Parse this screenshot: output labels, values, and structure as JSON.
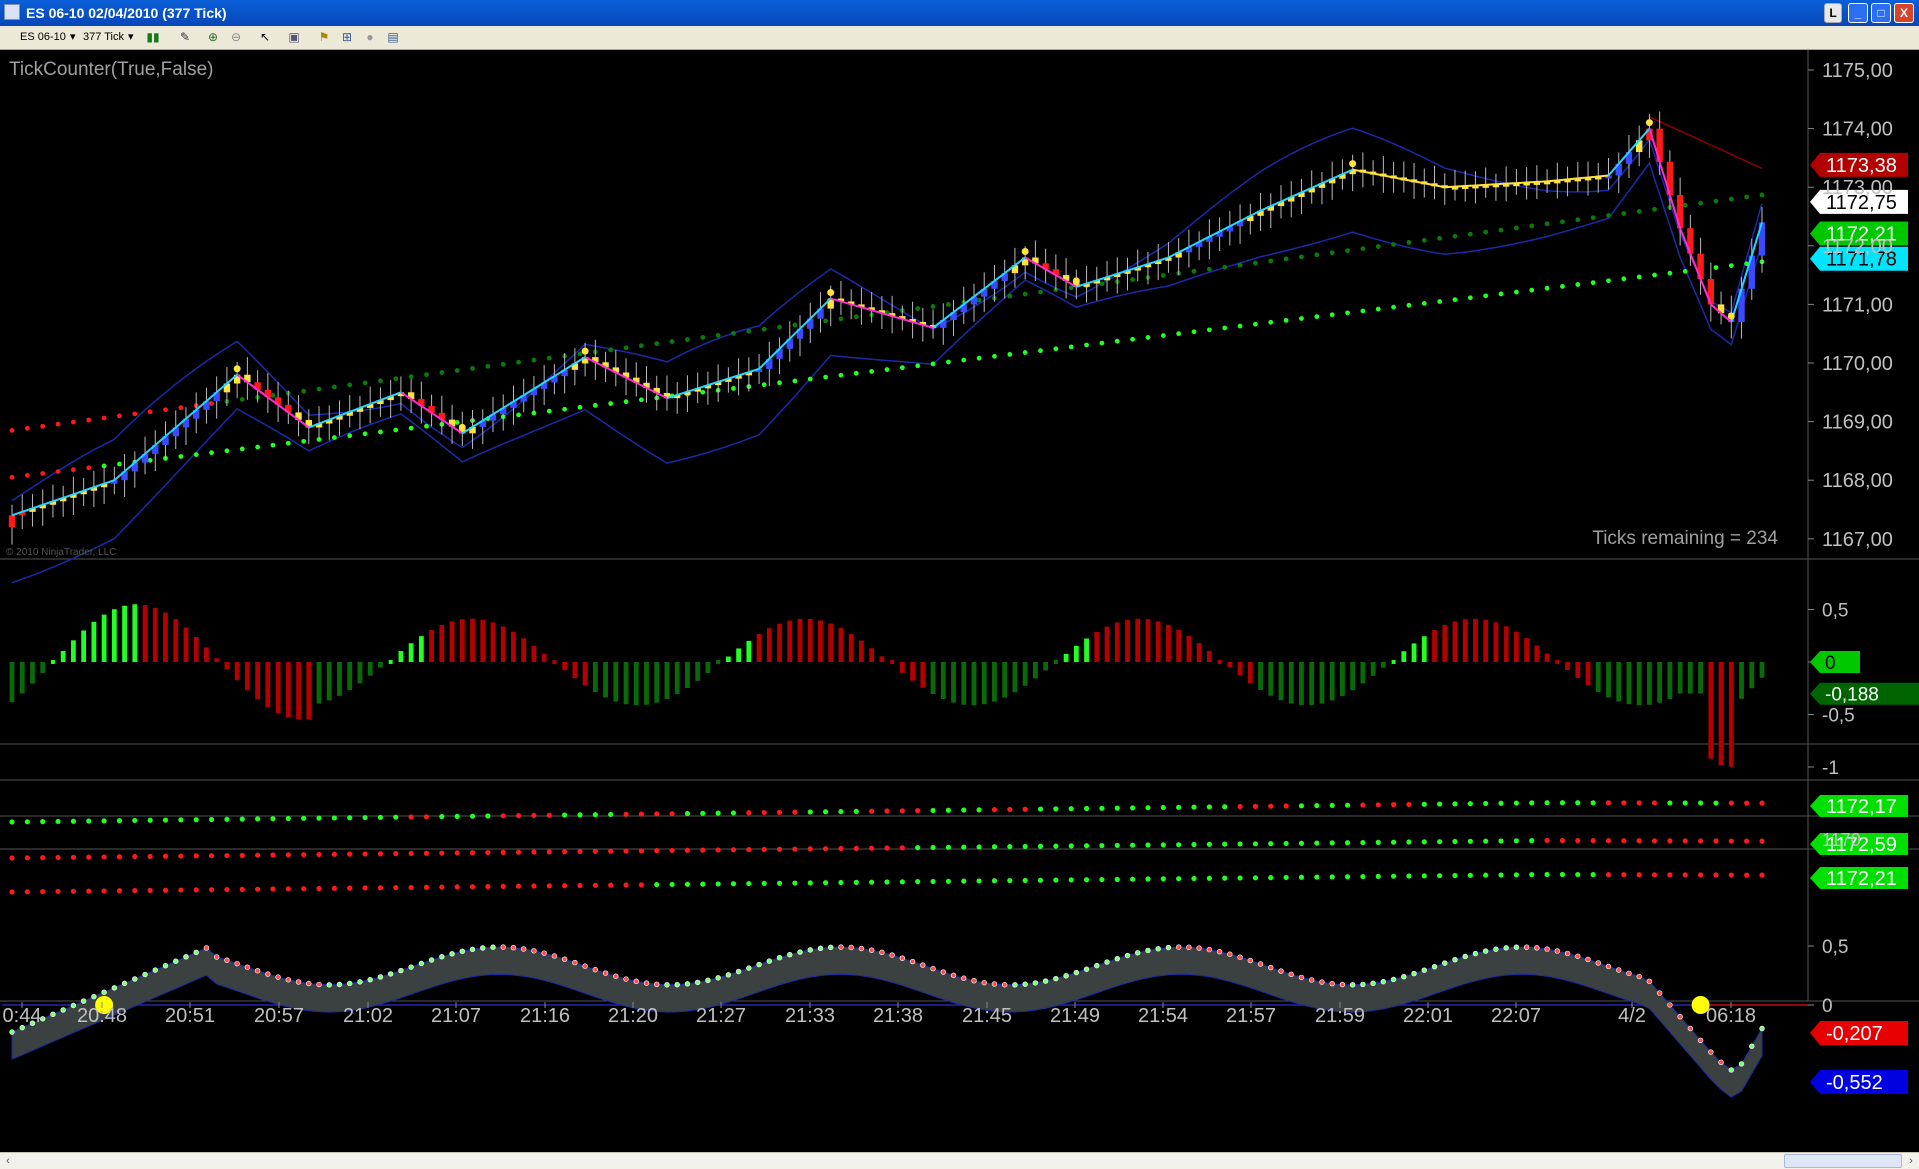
{
  "window": {
    "title": "ES 06-10  02/04/2010 (377 Tick)"
  },
  "toolbar": {
    "instrument": "ES 06-10",
    "interval": "377 Tick"
  },
  "icons": {
    "restore_left": "L",
    "minimize": "_",
    "maximize": "□",
    "close": "X",
    "dropdown": "▾",
    "bar_style": "bars-icon",
    "draw": "pencil-icon",
    "zoom_in": "zoom-in-icon",
    "zoom_out": "zoom-out-icon",
    "cursor": "cursor-icon",
    "properties": "properties-icon",
    "indicators": "indicators-icon",
    "strategies": "strategies-icon",
    "data_box": "data-box-icon",
    "scroll_left": "‹",
    "scroll_right": "›"
  },
  "main_panel": {
    "indicator_label": "TickCounter(True,False)",
    "ticks_remaining": "Ticks remaining = 234",
    "copyright": "© 2010 NinjaTrader, LLC",
    "y_axis_labels": [
      "1175,00",
      "1174,00",
      "1173,00",
      "1172,00",
      "1171,00",
      "1170,00",
      "1169,00",
      "1168,00",
      "1167,00"
    ],
    "y_axis_values": [
      1175,
      1174,
      1173,
      1172,
      1171,
      1170,
      1169,
      1168,
      1167
    ],
    "price_badges": [
      {
        "text": "1173,38",
        "value": 1173.38,
        "bg": "#b30000",
        "fg": "#ffffff"
      },
      {
        "text": "1172,75",
        "value": 1172.75,
        "bg": "#ffffff",
        "fg": "#000000"
      },
      {
        "text": "1172,21",
        "value": 1172.21,
        "bg": "#00c800",
        "fg": "#ffffff"
      },
      {
        "text": "1171,78",
        "value": 1171.78,
        "bg": "#00e5ff",
        "fg": "#000000"
      }
    ]
  },
  "histogram_panel": {
    "y_axis_labels": [
      "0,5",
      "0",
      "-0,5",
      "-1"
    ],
    "y_axis_values": [
      0.5,
      0,
      -0.5,
      -1
    ],
    "badges": [
      {
        "text": "0",
        "value": 0,
        "bg": "#00c800",
        "fg": "#000000"
      },
      {
        "text": "-0,188",
        "value": -0.188,
        "bg": "#006400",
        "fg": "#ffffff"
      }
    ]
  },
  "strip_panels": [
    {
      "badge": "1172,17"
    },
    {
      "badge": "1172,59"
    },
    {
      "badge": "1172,21",
      "axis_label": "1170"
    }
  ],
  "oscillator_panel": {
    "y_axis_labels": [
      "0,5",
      "0"
    ],
    "y_axis_values": [
      0.5,
      0
    ],
    "badges": [
      {
        "text": "-0,207",
        "value": -0.207,
        "bg": "#e60000",
        "fg": "#ffffff"
      },
      {
        "text": "-0,552",
        "value": -0.552,
        "bg": "#0000e0",
        "fg": "#ffffff"
      }
    ]
  },
  "time_axis": [
    "0:44",
    "20:48",
    "20:51",
    "20:57",
    "21:02",
    "21:07",
    "21:16",
    "21:20",
    "21:27",
    "21:33",
    "21:38",
    "21:45",
    "21:49",
    "21:54",
    "21:57",
    "21:59",
    "22:01",
    "22:07",
    "4/2",
    "06:18"
  ],
  "colors": {
    "up_bar": "#3a4bff",
    "down_bar": "#ff1a1a",
    "neutral_bar": "#ffe23a",
    "line_up": "#27d6ff",
    "line_down": "#ff2bd0",
    "line_flat": "#ffe23a",
    "dot_green": "#22ff22",
    "dot_dkgreen": "#0a7a0a",
    "dot_red": "#ff1a1a",
    "hist_green": "#22ff22",
    "hist_red": "#b30000",
    "hist_dkgreen": "#0a6a0a",
    "band": "#1c2aa8",
    "grid": "#3a3a3a",
    "axis_text": "#c0c0c0"
  }
}
